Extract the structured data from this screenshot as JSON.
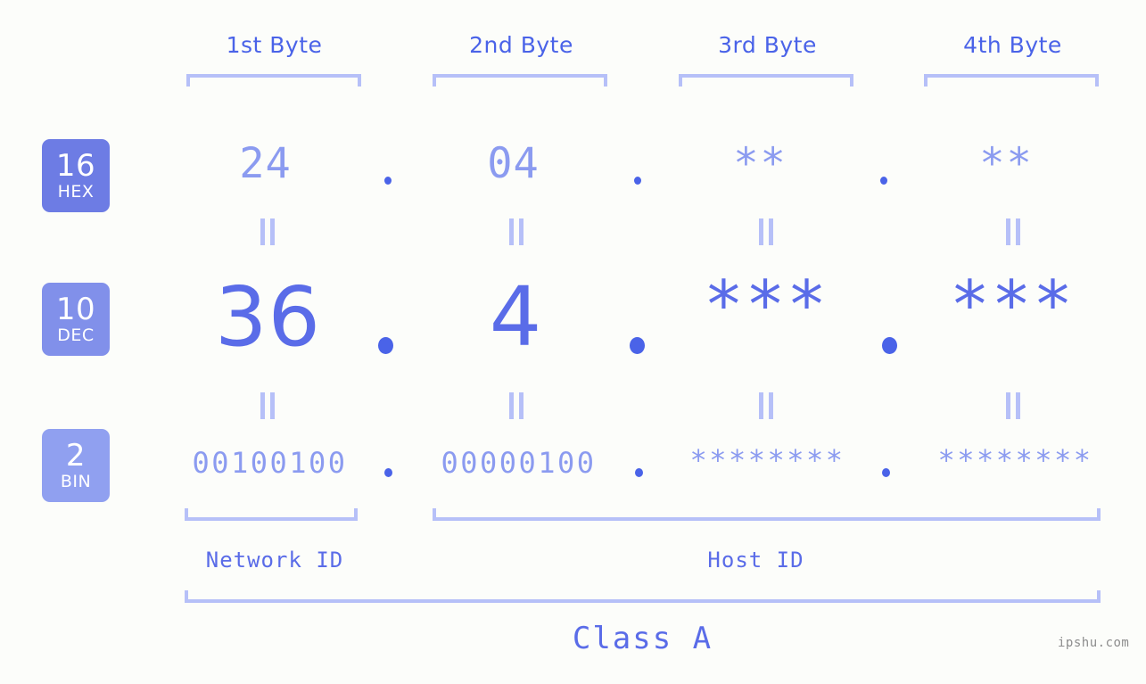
{
  "meta": {
    "background_color": "#fcfdfa",
    "accent_color": "#5a6ce8",
    "light_accent_color": "#8b9bf0",
    "bracket_color": "#b6c0f8",
    "watermark": "ipshu.com"
  },
  "byte_headers": [
    {
      "label": "1st Byte"
    },
    {
      "label": "2nd Byte"
    },
    {
      "label": "3rd Byte"
    },
    {
      "label": "4th Byte"
    }
  ],
  "bases": [
    {
      "number": "16",
      "name": "HEX",
      "color": "#6d7ce4"
    },
    {
      "number": "10",
      "name": "DEC",
      "color": "#8190ea"
    },
    {
      "number": "2",
      "name": "BIN",
      "color": "#90a0f0"
    }
  ],
  "rows": {
    "hex": {
      "base_number": "16",
      "base_name": "HEX",
      "values": [
        "24",
        "04",
        "**",
        "**"
      ],
      "separators": [
        ".",
        ".",
        "."
      ]
    },
    "dec": {
      "base_number": "10",
      "base_name": "DEC",
      "values": [
        "36",
        "4",
        "***",
        "***"
      ],
      "separators": [
        ".",
        ".",
        "."
      ]
    },
    "bin": {
      "base_number": "2",
      "base_name": "BIN",
      "values": [
        "00100100",
        "00000100",
        "********",
        "********"
      ],
      "separators": [
        ".",
        ".",
        "."
      ]
    }
  },
  "equivalence_mark": "‖",
  "sections": [
    {
      "label": "Network ID"
    },
    {
      "label": "Host ID"
    }
  ],
  "class": {
    "label": "Class A"
  }
}
